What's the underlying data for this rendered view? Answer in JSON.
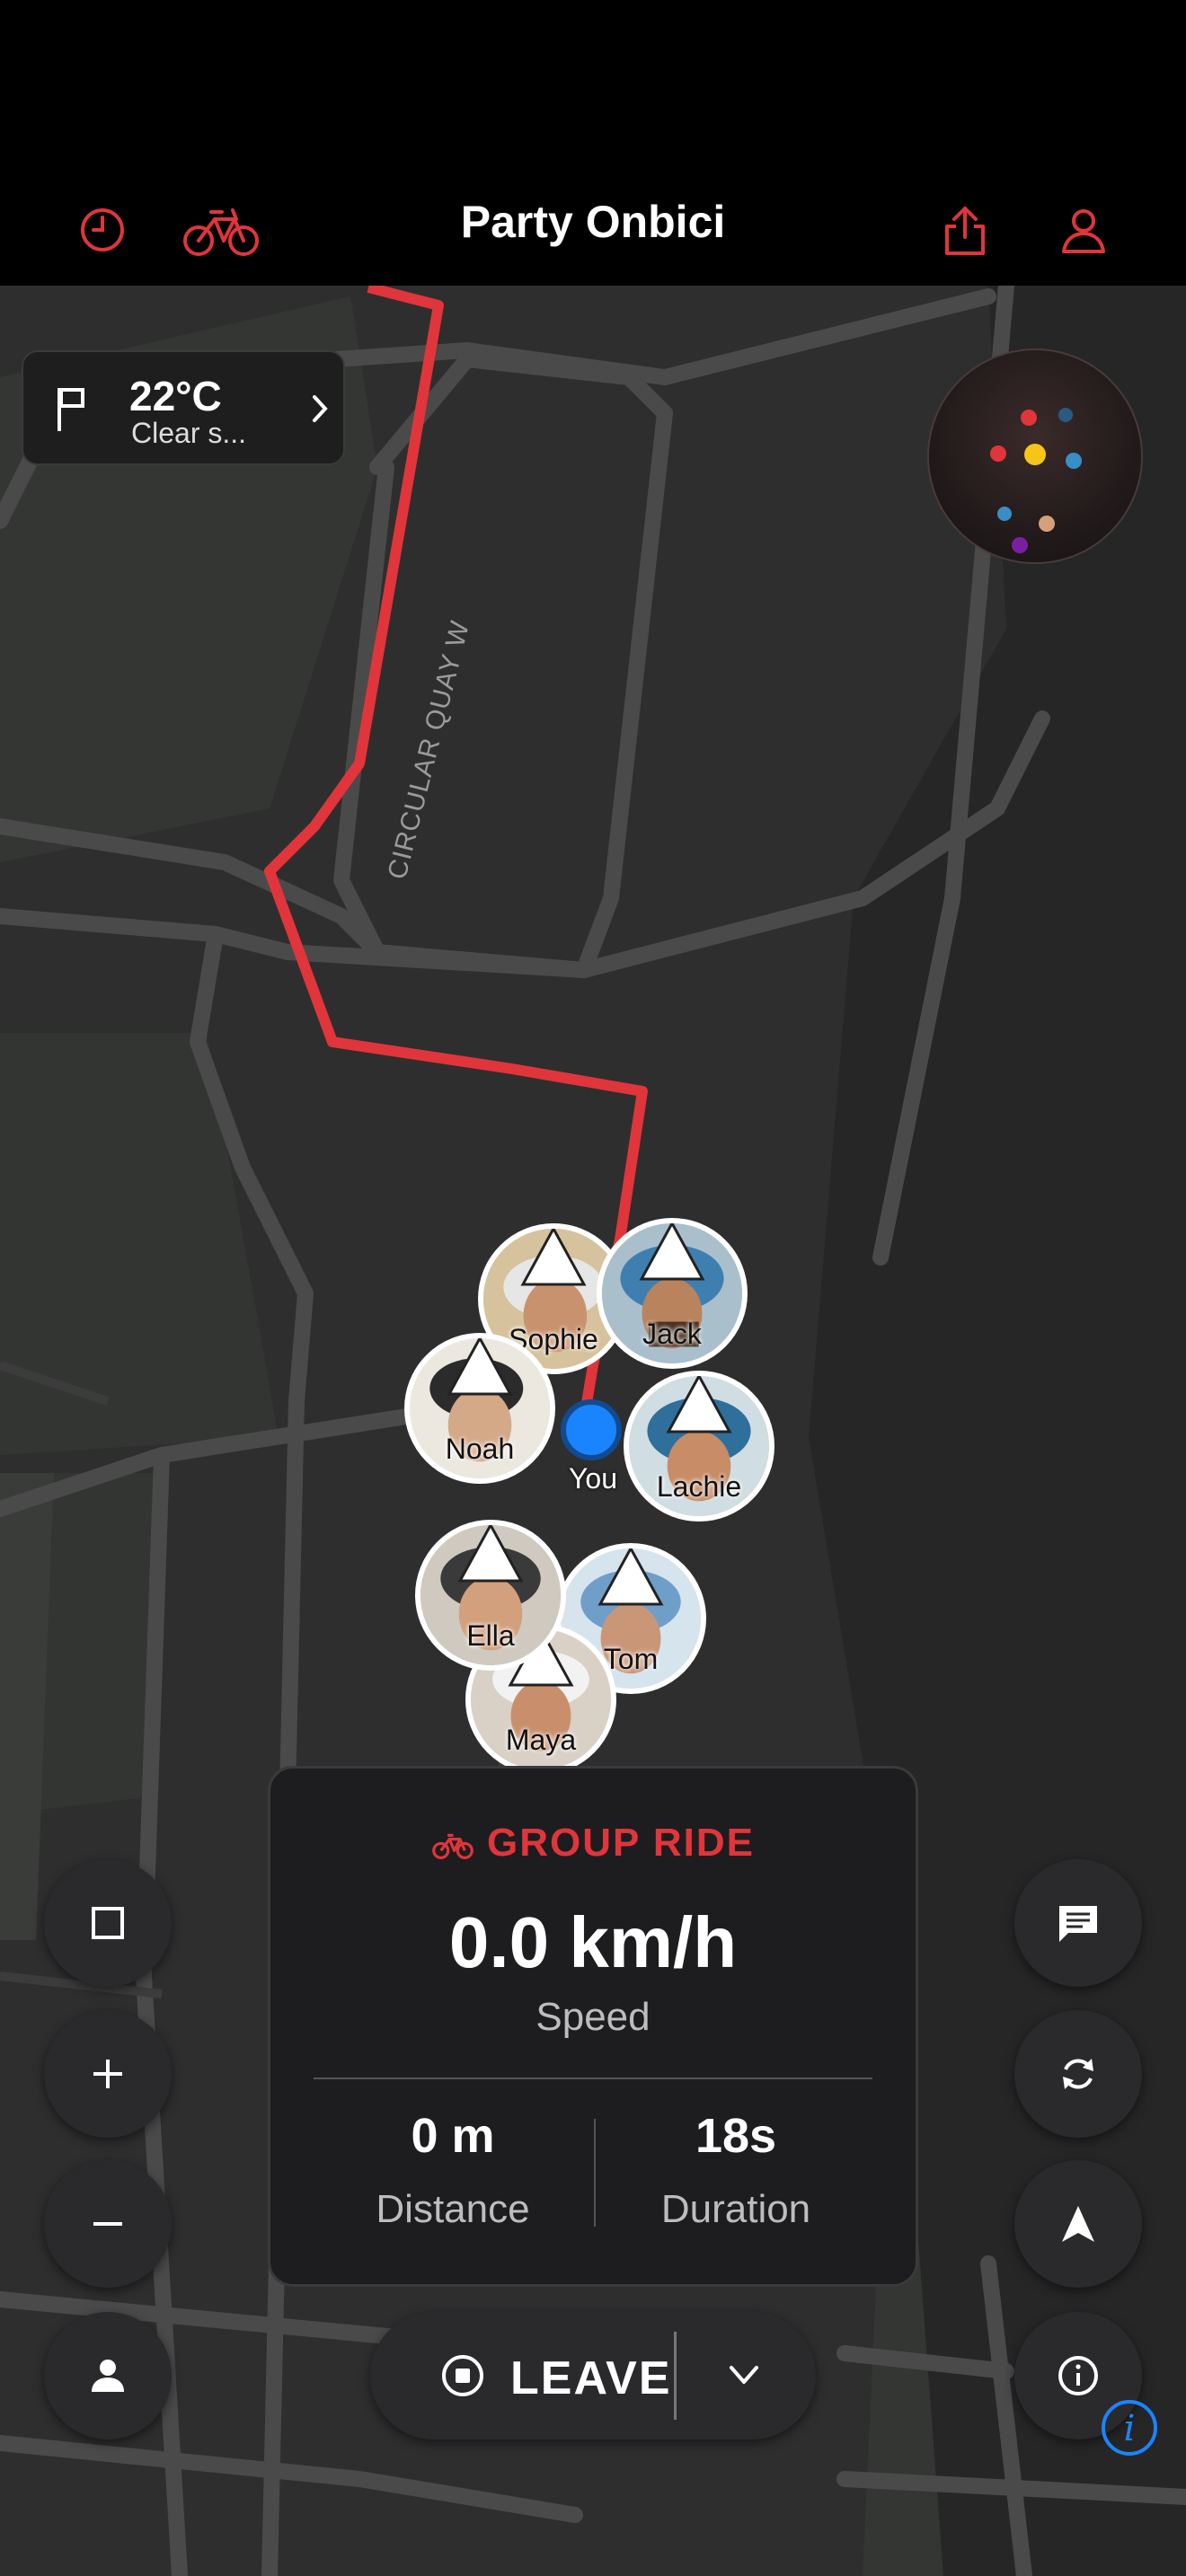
{
  "header": {
    "title": "Party Onbici",
    "history_icon": "history-icon",
    "bike_icon": "bicycle-icon",
    "share_icon": "share-icon",
    "profile_icon": "profile-icon"
  },
  "weather": {
    "temperature": "22°C",
    "condition": "Clear s...",
    "flag_icon": "flag-icon",
    "chevron_icon": "chevron-right-icon"
  },
  "map": {
    "street_label": "CIRCULAR QUAY W",
    "route_color": "#e0353b",
    "you_label": "You"
  },
  "riders": [
    {
      "name": "Sophie"
    },
    {
      "name": "Jack"
    },
    {
      "name": "Noah"
    },
    {
      "name": "Lachie"
    },
    {
      "name": "Ella"
    },
    {
      "name": "Tom"
    },
    {
      "name": "Maya"
    }
  ],
  "ride_panel": {
    "heading": "GROUP RIDE",
    "speed_value": "0.0 km/h",
    "speed_label": "Speed",
    "distance_value": "0 m",
    "distance_label": "Distance",
    "duration_value": "18s",
    "duration_label": "Duration"
  },
  "controls": {
    "leave_label": "LEAVE",
    "left_buttons": [
      "square-icon",
      "zoom-in-icon",
      "zoom-out-icon",
      "person-icon"
    ],
    "right_buttons": [
      "chat-icon",
      "refresh-icon",
      "navigate-icon",
      "info-icon"
    ]
  },
  "colors": {
    "accent": "#e0353b",
    "you_blue": "#1a84ff",
    "background": "#000000"
  }
}
